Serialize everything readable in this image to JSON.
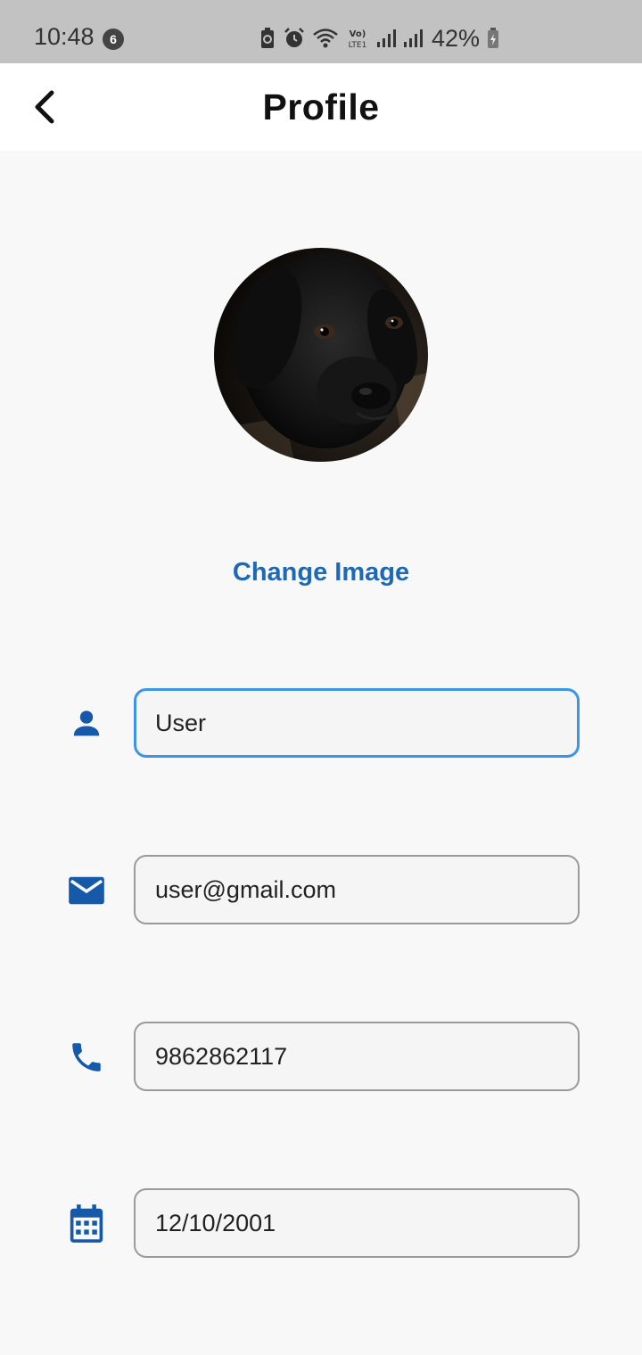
{
  "status_bar": {
    "time": "10:48",
    "notification_count": "6",
    "battery": "42%",
    "network_label": "Vo) LTE1",
    "icons": [
      "battery-saver-icon",
      "alarm-icon",
      "wifi-icon",
      "volte-icon",
      "signal-icon",
      "signal-icon",
      "battery-icon"
    ]
  },
  "header": {
    "title": "Profile",
    "back_icon": "chevron-left-icon"
  },
  "profile": {
    "avatar_description": "profile photo",
    "change_image_label": "Change Image"
  },
  "fields": {
    "name": {
      "icon": "person-icon",
      "value": "User",
      "focused": true
    },
    "email": {
      "icon": "mail-icon",
      "value": "user@gmail.com"
    },
    "phone": {
      "icon": "phone-icon",
      "value": "9862862117"
    },
    "dob": {
      "icon": "calendar-icon",
      "value": "12/10/2001"
    }
  },
  "colors": {
    "accent": "#1f68b3",
    "icon": "#1559a8",
    "focus_border": "#3c95e6",
    "status_bar": "#c2c2c2"
  }
}
